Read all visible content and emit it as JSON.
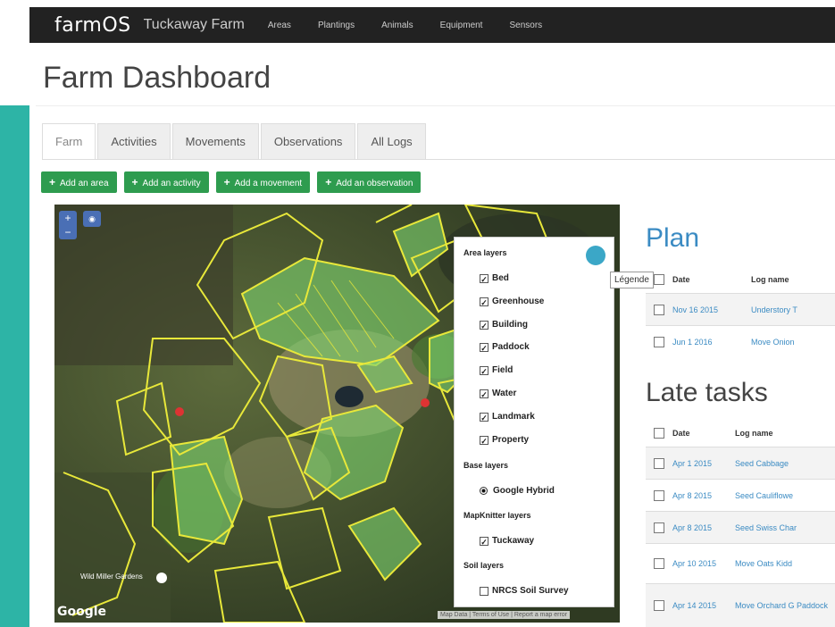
{
  "app": {
    "brand": "farmOS",
    "farm_name": "Tuckaway Farm",
    "nav": [
      "Areas",
      "Plantings",
      "Animals",
      "Equipment",
      "Sensors"
    ]
  },
  "page_title": "Farm Dashboard",
  "tabs": [
    {
      "label": "Farm",
      "active": true
    },
    {
      "label": "Activities"
    },
    {
      "label": "Movements"
    },
    {
      "label": "Observations"
    },
    {
      "label": "All Logs"
    }
  ],
  "action_buttons": [
    {
      "icon": "+",
      "label": "Add an area"
    },
    {
      "icon": "+",
      "label": "Add an activity"
    },
    {
      "icon": "+",
      "label": "Add a movement"
    },
    {
      "icon": "+",
      "label": "Add an observation"
    }
  ],
  "map": {
    "zoom_in": "+",
    "zoom_out": "−",
    "place_label": "Wild Miller Gardens",
    "google_logo": "Google",
    "attribution": "Map Data | Terms of Use | Report a map error",
    "tooltip": "Légende",
    "layer_panel": {
      "area_layers_title": "Area layers",
      "area_layers": [
        {
          "label": "Bed",
          "checked": true
        },
        {
          "label": "Greenhouse",
          "checked": true
        },
        {
          "label": "Building",
          "checked": true
        },
        {
          "label": "Paddock",
          "checked": true
        },
        {
          "label": "Field",
          "checked": true
        },
        {
          "label": "Water",
          "checked": true
        },
        {
          "label": "Landmark",
          "checked": true
        },
        {
          "label": "Property",
          "checked": true
        }
      ],
      "base_layers_title": "Base layers",
      "base_layers": [
        {
          "label": "Google Hybrid",
          "selected": true
        }
      ],
      "mapknitter_title": "MapKnitter layers",
      "mapknitter_layers": [
        {
          "label": "Tuckaway",
          "checked": true
        }
      ],
      "soil_title": "Soil layers",
      "soil_layers": [
        {
          "label": "NRCS Soil Survey",
          "checked": false
        }
      ]
    }
  },
  "plan": {
    "title": "Plan",
    "columns": [
      "Date",
      "Log name"
    ],
    "rows": [
      {
        "date": "Nov 16 2015",
        "name": "Understory T"
      },
      {
        "date": "Jun 1 2016",
        "name": "Move Onion"
      }
    ]
  },
  "late_tasks": {
    "title": "Late tasks",
    "columns": [
      "Date",
      "Log name"
    ],
    "rows": [
      {
        "date": "Apr 1 2015",
        "name": "Seed Cabbage"
      },
      {
        "date": "Apr 8 2015",
        "name": "Seed Cauliflowe"
      },
      {
        "date": "Apr 8 2015",
        "name": "Seed Swiss Char"
      },
      {
        "date": "Apr 10 2015",
        "name": "Move Oats Kidd"
      },
      {
        "date": "Apr 14 2015",
        "name": "Move Orchard G Paddock"
      }
    ]
  },
  "colors": {
    "teal_bar": "#2db4a6",
    "navbar": "#222222",
    "button_green": "#2e9c4f",
    "link_blue": "#3b8bc3",
    "area_outline": "#e8e83a",
    "area_fill": "#7ed56f"
  }
}
